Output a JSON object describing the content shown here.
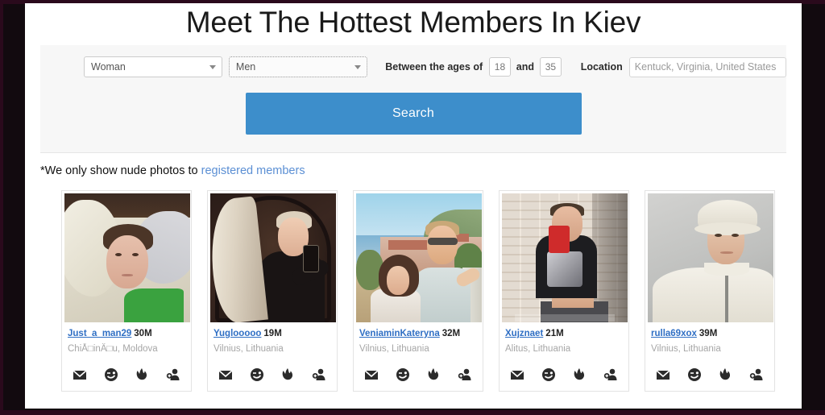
{
  "hero": {
    "title": "Meet The Hottest Members In Kiev"
  },
  "search": {
    "gender_select": {
      "value": "Woman",
      "caret_icon": "chevron-down-icon"
    },
    "seeking_select": {
      "value": "Men",
      "caret_icon": "chevron-down-icon"
    },
    "age_label": "Between the ages of",
    "age_min": "18",
    "and_label": "and",
    "age_max": "35",
    "location_label": "Location",
    "location_value": "Kentuck, Virginia, United States",
    "submit_label": "Search",
    "submit_color": "#3d8ecb"
  },
  "notice": {
    "text": "*We only show nude photos to ",
    "link_text": "registered members",
    "link_color": "#5b8fd4"
  },
  "actions": [
    {
      "name": "message-icon",
      "title": "Message"
    },
    {
      "name": "wink-icon",
      "title": "Wink"
    },
    {
      "name": "flame-icon",
      "title": "Hot"
    },
    {
      "name": "add-friend-icon",
      "title": "Add friend"
    }
  ],
  "members": [
    {
      "username": "Just_a_man29",
      "age": "30M",
      "location": "ChiÅ□inÄ□u, Moldova",
      "photo_alt": "person lying in bed wearing a green shirt"
    },
    {
      "username": "Yuglooooo",
      "age": "19M",
      "location": "Vilnius, Lithuania",
      "photo_alt": "mirror selfie, blond hair, dark clothing"
    },
    {
      "username": "VeniaminKateryna",
      "age": "32M",
      "location": "Vilnius, Lithuania",
      "photo_alt": "couple selfie at a coastal town"
    },
    {
      "username": "Xujznaet",
      "age": "21M",
      "location": "Alitus, Lithuania",
      "photo_alt": "mirror selfie with red phone against a stone wall"
    },
    {
      "username": "rulla69xox",
      "age": "39M",
      "location": "Vilnius, Lithuania",
      "photo_alt": "man in white bucket hat and white jacket"
    }
  ]
}
